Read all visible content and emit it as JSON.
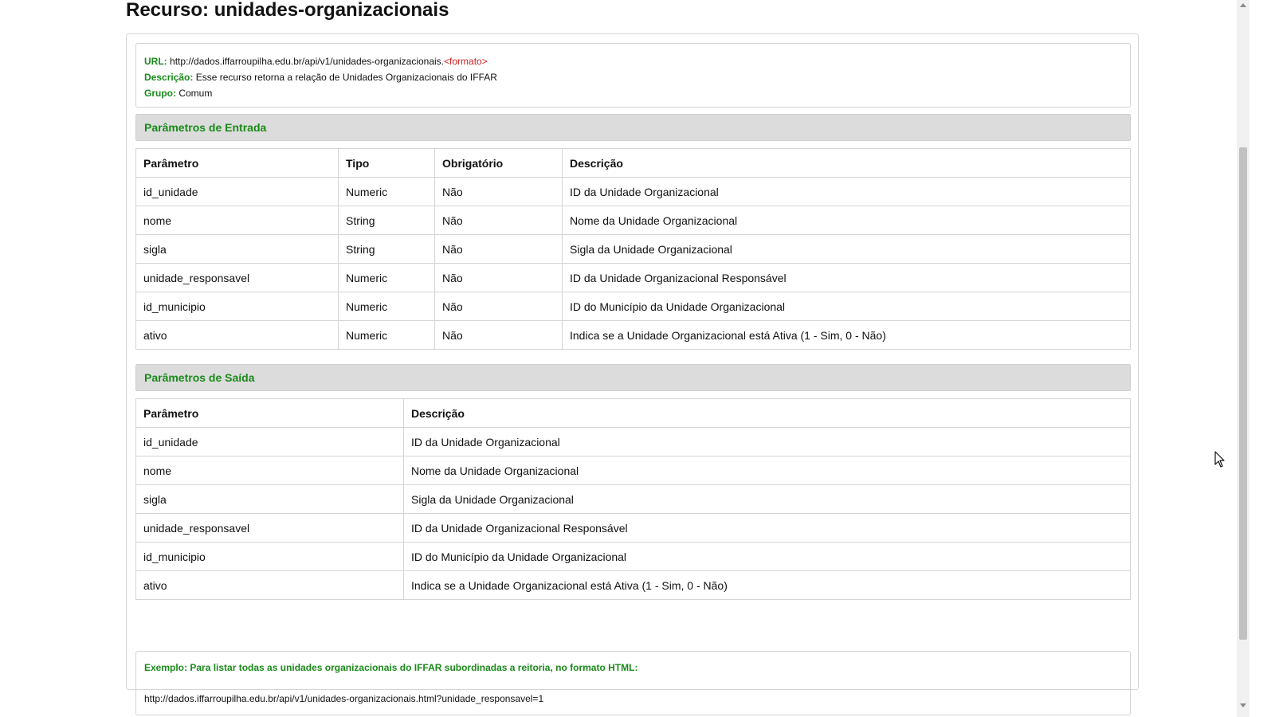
{
  "page": {
    "title": "Recurso: unidades-organizacionais"
  },
  "info": {
    "url_label": "URL:",
    "url_value": "http://dados.iffarroupilha.edu.br/api/v1/unidades-organizacionais.",
    "url_format": "<formato>",
    "descricao_label": "Descrição:",
    "descricao_value": "Esse recurso retorna a relação de Unidades Organizacionais do IFFAR",
    "grupo_label": "Grupo:",
    "grupo_value": "Comum"
  },
  "entrada": {
    "header": "Parâmetros de Entrada",
    "columns": [
      "Parâmetro",
      "Tipo",
      "Obrigatório",
      "Descrição"
    ],
    "rows": [
      [
        "id_unidade",
        "Numeric",
        "Não",
        "ID da Unidade Organizacional"
      ],
      [
        "nome",
        "String",
        "Não",
        "Nome da Unidade Organizacional"
      ],
      [
        "sigla",
        "String",
        "Não",
        "Sigla da Unidade Organizacional"
      ],
      [
        "unidade_responsavel",
        "Numeric",
        "Não",
        "ID da Unidade Organizacional Responsável"
      ],
      [
        "id_municipio",
        "Numeric",
        "Não",
        "ID do Município da Unidade Organizacional"
      ],
      [
        "ativo",
        "Numeric",
        "Não",
        "Indica se a Unidade Organizacional está Ativa (1 - Sim, 0 - Não)"
      ]
    ]
  },
  "saida": {
    "header": "Parâmetros de Saída",
    "columns": [
      "Parâmetro",
      "Descrição"
    ],
    "rows": [
      [
        "id_unidade",
        "ID da Unidade Organizacional"
      ],
      [
        "nome",
        "Nome da Unidade Organizacional"
      ],
      [
        "sigla",
        "Sigla da Unidade Organizacional"
      ],
      [
        "unidade_responsavel",
        "ID da Unidade Organizacional Responsável"
      ],
      [
        "id_municipio",
        "ID do Município da Unidade Organizacional"
      ],
      [
        "ativo",
        "Indica se a Unidade Organizacional está Ativa (1 - Sim, 0 - Não)"
      ]
    ]
  },
  "exemplo": {
    "title": "Exemplo: Para listar todas as unidades organizacionais do IFFAR subordinadas a reitoria, no formato HTML:",
    "url": "http://dados.iffarroupilha.edu.br/api/v1/unidades-organizacionais.html?unidade_responsavel=1"
  },
  "colors": {
    "label_green": "#1a8a1a",
    "format_red": "#d01f1f",
    "section_bg": "#dcdcdc"
  },
  "icons": {
    "cursor": "mouse-pointer-icon"
  }
}
